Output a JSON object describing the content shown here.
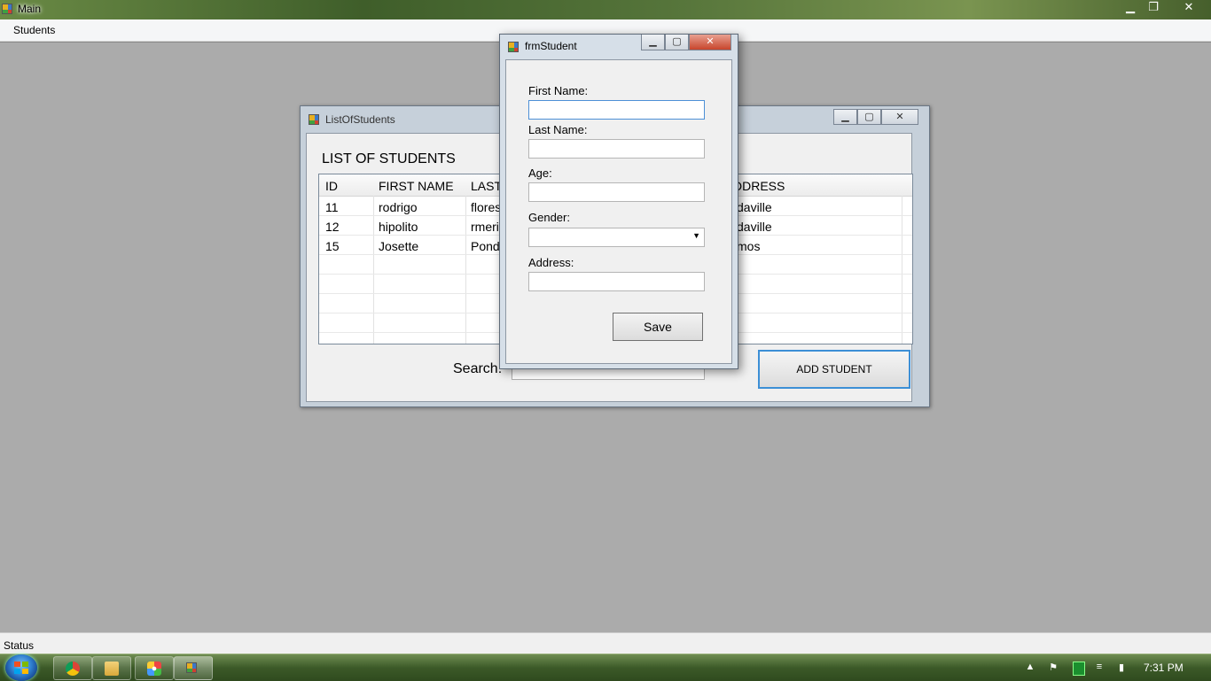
{
  "main_window": {
    "title": "Main"
  },
  "menu": {
    "students": "Students"
  },
  "status_bar": {
    "text": "Status"
  },
  "list_window": {
    "title": "ListOfStudents",
    "heading": "LIST OF STUDENTS",
    "columns": [
      "ID",
      "FIRST NAME",
      "LAST",
      "DDRESS"
    ],
    "rows": [
      {
        "id": "11",
        "first_name": "rodrigo",
        "last_name": "flores",
        "address": "daville"
      },
      {
        "id": "12",
        "first_name": "hipolito",
        "last_name": "rmeri",
        "address": "daville"
      },
      {
        "id": "15",
        "first_name": "Josette",
        "last_name": "Pond",
        "address": "mos"
      }
    ],
    "search_label": "Search:",
    "add_button": "ADD STUDENT"
  },
  "dialog": {
    "title": "frmStudent",
    "first_name_label": "First Name:",
    "last_name_label": "Last Name:",
    "age_label": "Age:",
    "gender_label": "Gender:",
    "address_label": "Address:",
    "first_name_value": "",
    "last_name_value": "",
    "age_value": "",
    "gender_value": "",
    "address_value": "",
    "save_button": "Save"
  },
  "taskbar": {
    "clock": "7:31 PM"
  },
  "icons": {
    "app": "app-icon",
    "minimize": "minimize-icon",
    "maximize": "maximize-icon",
    "close": "close-icon",
    "dropdown": "chevron-down-icon",
    "start": "windows-start-icon",
    "chrome": "chrome-icon",
    "explorer": "folder-icon",
    "media": "media-player-icon"
  },
  "colors": {
    "accent_focus": "#4d90d6",
    "mdi_background": "#ababab",
    "close_button": "#c8452c"
  }
}
